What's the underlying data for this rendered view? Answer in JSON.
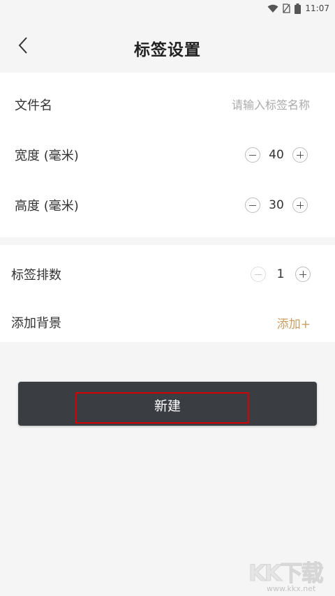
{
  "status_bar": {
    "time": "11:07",
    "icons": [
      "wifi-icon",
      "no-sim-icon",
      "battery-icon"
    ]
  },
  "header": {
    "title": "标签设置",
    "back_icon": "chevron-left-icon"
  },
  "settings": {
    "filename": {
      "label": "文件名",
      "value": "",
      "placeholder": "请输入标签名称"
    },
    "width": {
      "label": "宽度 (毫米)",
      "value": "40"
    },
    "height": {
      "label": "高度 (毫米)",
      "value": "30"
    },
    "rows": {
      "label": "标签排数",
      "value": "1"
    },
    "background": {
      "label": "添加背景",
      "action": "添加+"
    }
  },
  "create_button": {
    "label": "新建"
  },
  "watermark": {
    "logo": "KK下载",
    "url": "www.kkx.net"
  },
  "colors": {
    "accent": "#c8a063",
    "button_bg": "#3a3d42",
    "page_bg": "#f5f5f5",
    "highlight": "#d40000"
  }
}
